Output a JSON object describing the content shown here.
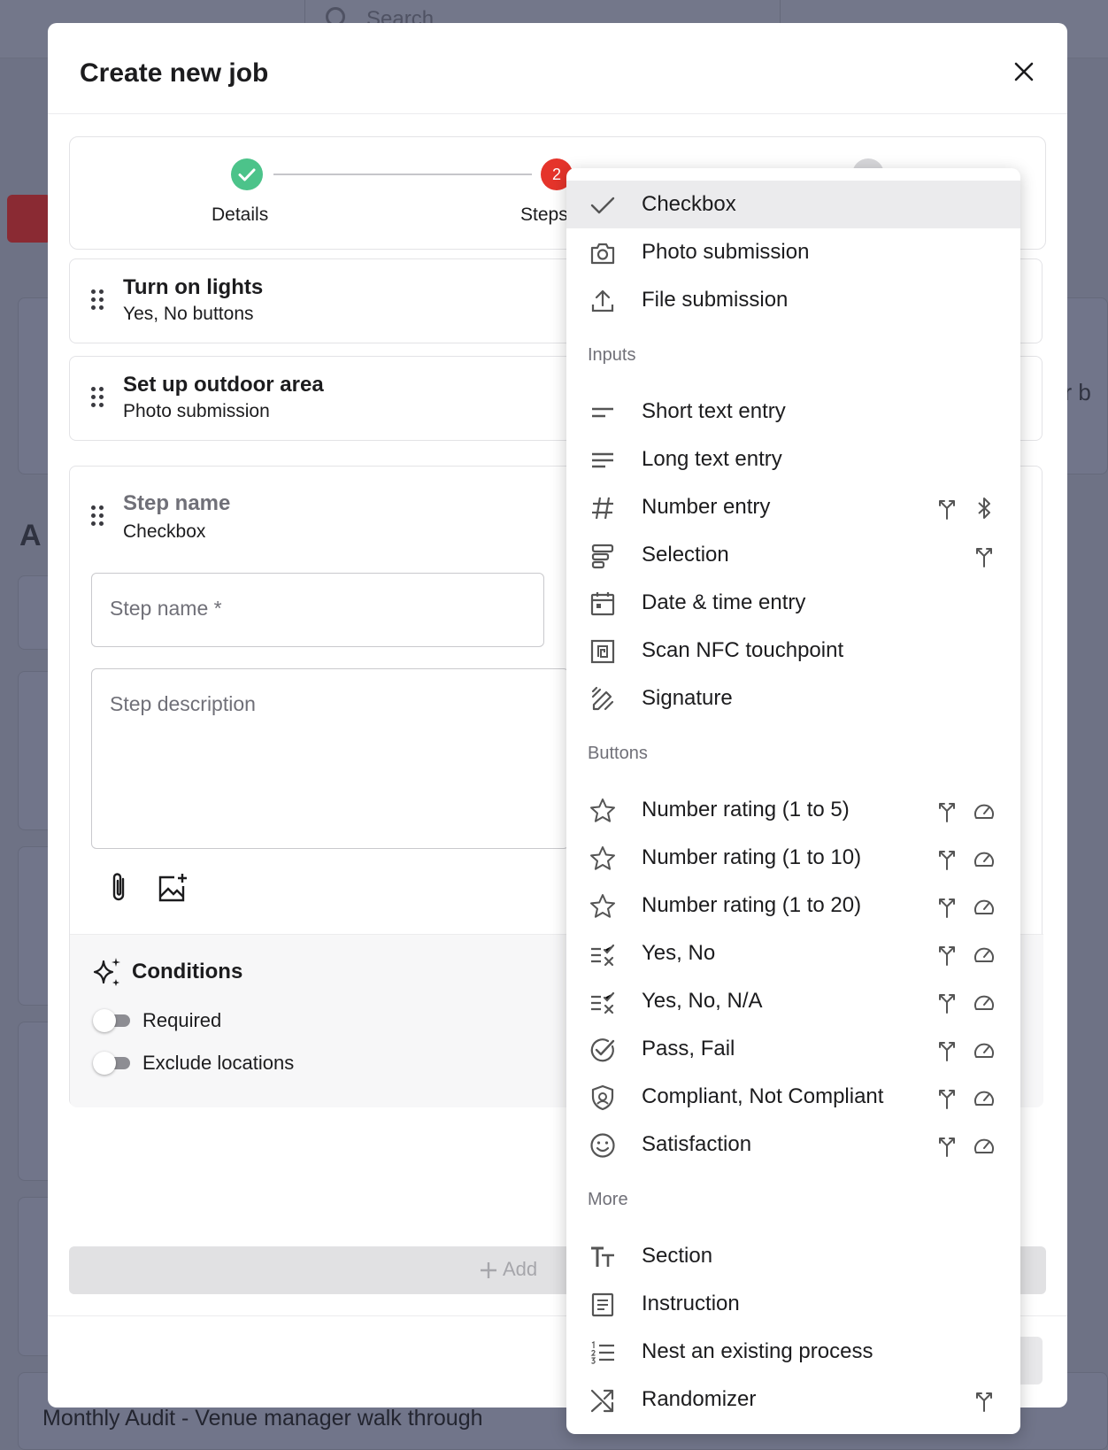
{
  "background": {
    "search_placeholder": "Search",
    "partial_text_right": "ur b",
    "partial_heading": "A",
    "bottom_item": "Monthly Audit - Venue manager walk through"
  },
  "modal": {
    "title": "Create new job",
    "stepper": {
      "steps": [
        {
          "label": "Details",
          "state": "complete"
        },
        {
          "label": "Steps",
          "state": "active",
          "number": "2"
        }
      ]
    },
    "steps": [
      {
        "title": "Turn on lights",
        "subtitle": "Yes, No buttons"
      },
      {
        "title": "Set up outdoor area",
        "subtitle": "Photo submission"
      }
    ],
    "editing_step": {
      "title": "Step name",
      "subtitle": "Checkbox",
      "name_placeholder": "Step name *",
      "description_placeholder": "Step description"
    },
    "conditions": {
      "title": "Conditions",
      "toggles": [
        {
          "label": "Required",
          "on": false
        },
        {
          "label": "Exclude locations",
          "on": false
        }
      ]
    },
    "add_button_label": "Add"
  },
  "menu": {
    "items_top": [
      {
        "label": "Checkbox",
        "icon": "check-icon",
        "selected": true
      },
      {
        "label": "Photo submission",
        "icon": "camera-icon"
      },
      {
        "label": "File submission",
        "icon": "upload-icon"
      }
    ],
    "inputs_header": "Inputs",
    "inputs": [
      {
        "label": "Short text entry",
        "icon": "short-text-icon"
      },
      {
        "label": "Long text entry",
        "icon": "long-text-icon"
      },
      {
        "label": "Number entry",
        "icon": "hash-icon",
        "badges": [
          "branch-icon",
          "bluetooth-icon"
        ]
      },
      {
        "label": "Selection",
        "icon": "selection-icon",
        "badges": [
          "branch-icon"
        ]
      },
      {
        "label": "Date & time entry",
        "icon": "calendar-icon"
      },
      {
        "label": "Scan NFC touchpoint",
        "icon": "nfc-icon"
      },
      {
        "label": "Signature",
        "icon": "signature-icon"
      }
    ],
    "buttons_header": "Buttons",
    "buttons": [
      {
        "label": "Number rating (1 to 5)",
        "icon": "star-icon",
        "badges": [
          "branch-icon",
          "gauge-icon"
        ]
      },
      {
        "label": "Number rating (1 to 10)",
        "icon": "star-icon",
        "badges": [
          "branch-icon",
          "gauge-icon"
        ]
      },
      {
        "label": "Number rating (1 to 20)",
        "icon": "star-icon",
        "badges": [
          "branch-icon",
          "gauge-icon"
        ]
      },
      {
        "label": "Yes, No",
        "icon": "yes-no-icon",
        "badges": [
          "branch-icon",
          "gauge-icon"
        ]
      },
      {
        "label": "Yes, No, N/A",
        "icon": "yes-no-icon",
        "badges": [
          "branch-icon",
          "gauge-icon"
        ]
      },
      {
        "label": "Pass, Fail",
        "icon": "pass-fail-icon",
        "badges": [
          "branch-icon",
          "gauge-icon"
        ]
      },
      {
        "label": "Compliant, Not Compliant",
        "icon": "shield-icon",
        "badges": [
          "branch-icon",
          "gauge-icon"
        ]
      },
      {
        "label": "Satisfaction",
        "icon": "smiley-icon",
        "badges": [
          "branch-icon",
          "gauge-icon"
        ]
      }
    ],
    "more_header": "More",
    "more": [
      {
        "label": "Section",
        "icon": "text-size-icon"
      },
      {
        "label": "Instruction",
        "icon": "document-icon"
      },
      {
        "label": "Nest an existing process",
        "icon": "numbered-list-icon"
      },
      {
        "label": "Randomizer",
        "icon": "shuffle-icon",
        "badges": [
          "branch-icon"
        ]
      }
    ]
  },
  "colors": {
    "complete": "#4cc38a",
    "active": "#e5342b",
    "selected_row": "#ebebed",
    "overlay": "#6e7285"
  }
}
